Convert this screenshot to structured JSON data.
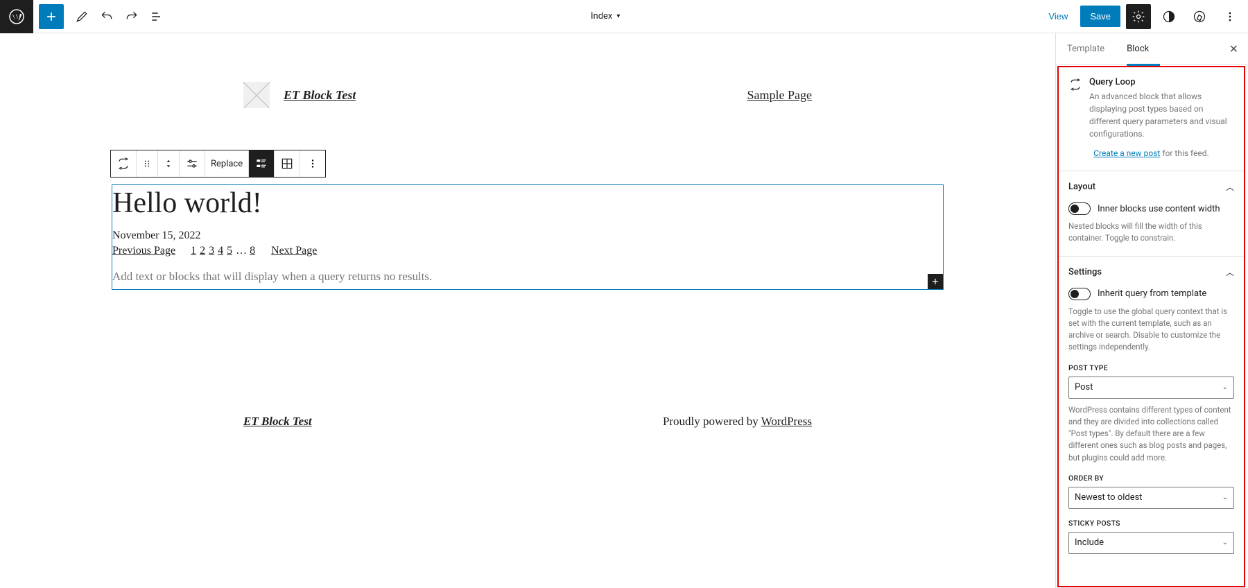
{
  "topbar": {
    "template_label": "Index",
    "view": "View",
    "save": "Save"
  },
  "canvas": {
    "site_title": "ET Block Test",
    "nav_sample": "Sample Page",
    "toolbar": {
      "replace": "Replace"
    },
    "post_title": "Hello world!",
    "post_date": "November 15, 2022",
    "pagination": {
      "prev": "Previous Page",
      "next": "Next Page",
      "nums": [
        "1",
        "2",
        "3",
        "4",
        "5",
        "…",
        "8"
      ]
    },
    "no_results_placeholder": "Add text or blocks that will display when a query returns no results.",
    "footer_title": "ET Block Test",
    "footer_powered_prefix": "Proudly powered by ",
    "footer_powered_link": "WordPress"
  },
  "sidebar": {
    "tabs": {
      "template": "Template",
      "block": "Block"
    },
    "block_header": {
      "title": "Query Loop",
      "desc": "An advanced block that allows displaying post types based on different query parameters and visual configurations.",
      "create_link": "Create a new post",
      "create_suffix": " for this feed."
    },
    "layout": {
      "title": "Layout",
      "toggle_label": "Inner blocks use content width",
      "help": "Nested blocks will fill the width of this container. Toggle to constrain."
    },
    "settings": {
      "title": "Settings",
      "toggle_label": "Inherit query from template",
      "help": "Toggle to use the global query context that is set with the current template, such as an archive or search. Disable to customize the settings independently.",
      "post_type_label": "Post Type",
      "post_type_value": "Post",
      "post_type_help": "WordPress contains different types of content and they are divided into collections called \"Post types\". By default there are a few different ones such as blog posts and pages, but plugins could add more.",
      "order_by_label": "Order By",
      "order_by_value": "Newest to oldest",
      "sticky_label": "Sticky Posts",
      "sticky_value": "Include"
    }
  }
}
